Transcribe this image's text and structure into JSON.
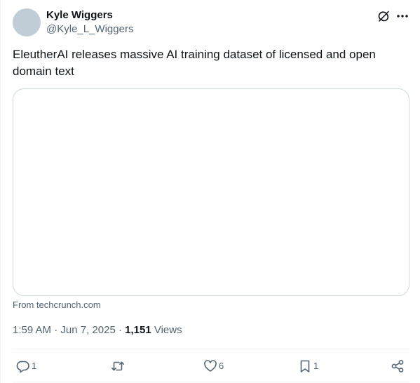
{
  "author": {
    "name": "Kyle Wiggers",
    "handle": "@Kyle_L_Wiggers"
  },
  "tweet": {
    "text": "EleutherAI releases massive AI training dataset of licensed and open domain text"
  },
  "card": {
    "source": "From techcrunch.com"
  },
  "meta": {
    "time": "1:59 AM",
    "separator": " · ",
    "date": "Jun 7, 2025",
    "separator2": " · ",
    "views_count": "1,151",
    "views_label": " Views"
  },
  "actions": {
    "reply_count": "1",
    "retweet_count": "",
    "like_count": "6",
    "bookmark_count": "1"
  },
  "icons": {
    "grok": "grok-icon",
    "more": "more-icon",
    "reply": "reply-icon",
    "retweet": "retweet-icon",
    "like": "heart-icon",
    "bookmark": "bookmark-icon",
    "share": "share-icon"
  },
  "colors": {
    "text": "#0f1419",
    "secondary": "#536471",
    "border": "#cfd9de",
    "divider": "#eff3f4",
    "avatar": "#c1cdd6"
  }
}
